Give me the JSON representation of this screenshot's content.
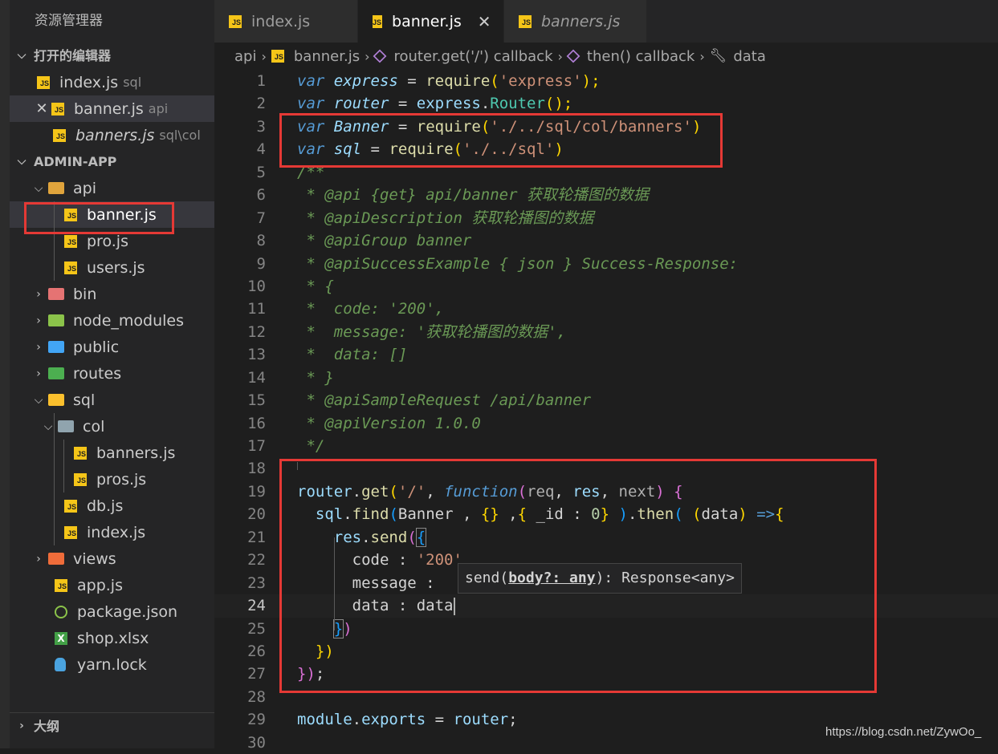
{
  "sidebar": {
    "title": "资源管理器",
    "open_editors_label": "打开的编辑器",
    "open_editors": [
      {
        "name": "index.js",
        "desc": "sql"
      },
      {
        "name": "banner.js",
        "desc": "api"
      },
      {
        "name": "banners.js",
        "desc": "sql\\col"
      }
    ],
    "project_label": "ADMIN-APP",
    "tree": {
      "api": "api",
      "banner": "banner.js",
      "pro": "pro.js",
      "users": "users.js",
      "bin": "bin",
      "node_modules": "node_modules",
      "public": "public",
      "routes": "routes",
      "sql": "sql",
      "col": "col",
      "banners": "banners.js",
      "pros": "pros.js",
      "db": "db.js",
      "index": "index.js",
      "views": "views",
      "app": "app.js",
      "package": "package.json",
      "shop": "shop.xlsx",
      "yarn": "yarn.lock"
    },
    "outline_label": "大纲"
  },
  "tabs": [
    {
      "label": "index.js"
    },
    {
      "label": "banner.js"
    },
    {
      "label": "banners.js"
    }
  ],
  "breadcrumb": {
    "folder": "api",
    "file": "banner.js",
    "sym1": "router.get('/') callback",
    "sym2": "then() callback",
    "sym3": "data"
  },
  "line_numbers": [
    "1",
    "2",
    "3",
    "4",
    "5",
    "6",
    "7",
    "8",
    "9",
    "10",
    "11",
    "12",
    "13",
    "14",
    "15",
    "16",
    "17",
    "18",
    "19",
    "20",
    "21",
    "22",
    "23",
    "24",
    "25",
    "26",
    "27",
    "28",
    "29",
    "30"
  ],
  "code": {
    "l1": {
      "kw": "var",
      "name": "express",
      "op": " = ",
      "fn": "require",
      "p1": "(",
      "str": "'express'",
      "p2": ");"
    },
    "l2": {
      "kw": "var",
      "name": "router",
      "op": " = ",
      "obj": "express",
      "dot": ".",
      "cls": "Router",
      "p": "();"
    },
    "l3": {
      "kw": "var",
      "name": "Banner",
      "op": " = ",
      "fn": "require",
      "p1": "(",
      "str": "'./../sql/col/banners'",
      "p2": ")"
    },
    "l4": {
      "kw": "var",
      "name": "sql",
      "op": " = ",
      "fn": "require",
      "p1": "(",
      "str": "'./../sql'",
      "p2": ")"
    },
    "l5": "/**",
    "l6": {
      "tag": " * @api",
      "rest": " {get} api/banner 获取轮播图的数据"
    },
    "l7": {
      "tag": " * @apiDescription",
      "rest": " 获取轮播图的数据"
    },
    "l8": {
      "tag": " * @apiGroup",
      "rest": " banner"
    },
    "l9": {
      "tag": " * @apiSuccessExample",
      "rest": " { json } Success-Response:"
    },
    "l10": " * {",
    "l11": " *  code: '200',",
    "l12": " *  message: '获取轮播图的数据',",
    "l13": " *  data: []",
    "l14": " * }",
    "l15": {
      "tag": " * @apiSampleRequest",
      "rest": " /api/banner"
    },
    "l16": {
      "tag": " * @apiVersion",
      "rest": " 1.0.0"
    },
    "l17": " */",
    "l19": {
      "obj": "router",
      "dot": ".",
      "method": "get",
      "p1": "(",
      "str": "'/'",
      "c": ", ",
      "fnkw": "function",
      "p2": "(",
      "a1": "req",
      "c1": ", ",
      "a2": "res",
      "c2": ", ",
      "a3": "next",
      "p3": ")",
      "sp": " ",
      "b": "{"
    },
    "l20": {
      "obj": "sql",
      "dot": ".",
      "method": "find",
      "p1": "(",
      "arg": "Banner ,",
      "b1": " {}",
      "c": " ,",
      "b2": "{",
      "key": " _id",
      "colon": " : ",
      "num": "0",
      "b3": "}",
      "p2": " )",
      "dot2": ".",
      "then": "then",
      "p3": "( ",
      "p4": "(",
      "param": "data",
      "p5": ")",
      "arrow": " =>",
      "b4": "{"
    },
    "l21": {
      "obj": "res",
      "dot": ".",
      "method": "send",
      "p": "(",
      "b": "{"
    },
    "l22": {
      "key": "code",
      "colon": " : ",
      "str": "'200'"
    },
    "l23": {
      "key": "message",
      "colon": " :"
    },
    "l24": {
      "key": "data",
      "colon": " : ",
      "val": "data"
    },
    "l25": {
      "b": "}",
      "p": ")"
    },
    "l26": {
      "p": "})"
    },
    "l27": {
      "b": "})",
      "semi": ";"
    },
    "l29": {
      "obj": "module",
      "dot": ".",
      "prop": "exports",
      "op": " = ",
      "val": "router",
      "semi": ";"
    }
  },
  "hover": {
    "prefix": "send(",
    "param": "body?: any",
    "suffix": "): Response<any>"
  },
  "watermark": "https://blog.csdn.net/ZywOo_"
}
